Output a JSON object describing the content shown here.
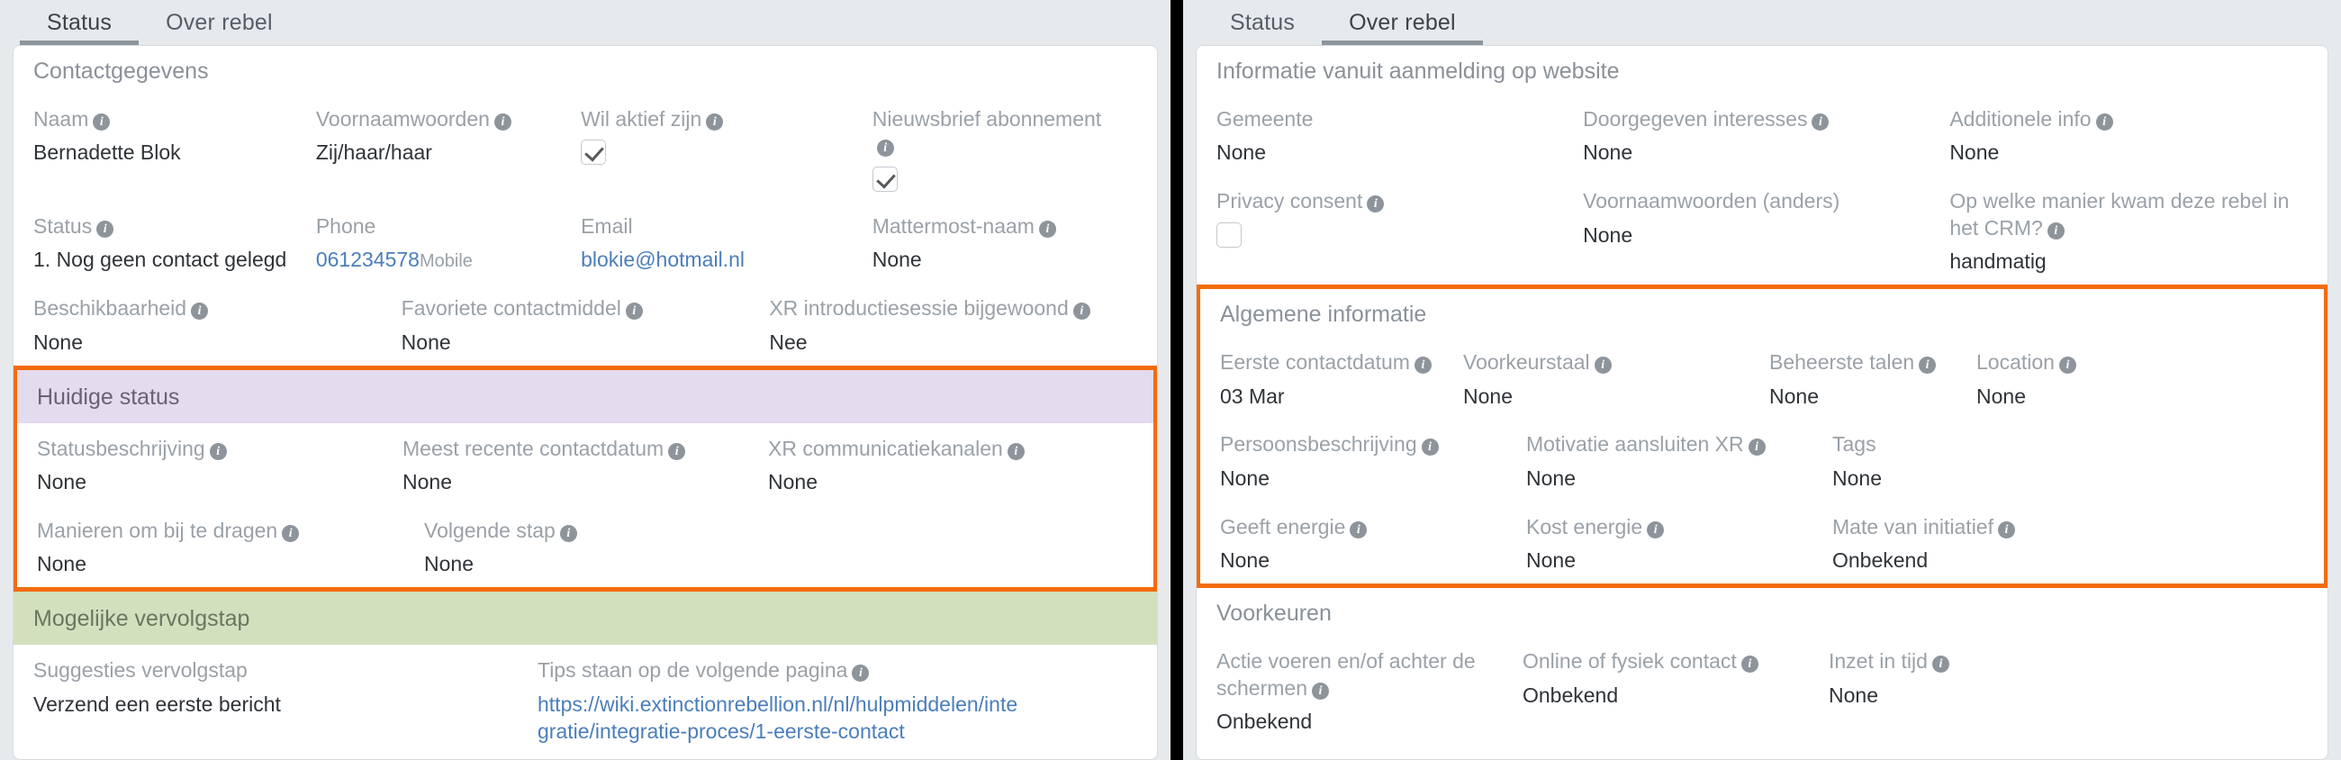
{
  "left_panel": {
    "tabs": [
      {
        "label": "Status",
        "active": true
      },
      {
        "label": "Over rebel",
        "active": false
      }
    ],
    "sections": [
      {
        "title": "Contactgegevens",
        "style": "plain",
        "rows": [
          [
            {
              "label": "Naam",
              "info": true,
              "value": "Bernadette Blok"
            },
            {
              "label": "Voornaamwoorden",
              "info": true,
              "value": "Zij/haar/haar"
            },
            {
              "label": "Wil aktief zijn",
              "info": true,
              "value": "",
              "checkbox": "checked"
            },
            {
              "label": "Nieuwsbrief abonnement",
              "info": true,
              "value": "",
              "checkbox": "checked",
              "label_wraps": true
            }
          ],
          [
            {
              "label": "Status",
              "info": true,
              "value": "1. Nog geen contact gelegd"
            },
            {
              "label": "Phone",
              "info": false,
              "value": "061234578",
              "value_link": true,
              "value_sub": "Mobile"
            },
            {
              "label": "Email",
              "info": false,
              "value": "blokie@hotmail.nl",
              "value_link": true
            },
            {
              "label": "Mattermost-naam",
              "info": true,
              "value": "None"
            }
          ],
          [
            {
              "label": "Beschikbaarheid",
              "info": true,
              "value": "None"
            },
            {
              "label": "Favoriete contactmiddel",
              "info": true,
              "value": "None"
            },
            {
              "label": "XR introductiesessie bijgewoond",
              "info": true,
              "value": "Nee"
            }
          ]
        ]
      },
      {
        "title": "Huidige status",
        "style": "purple",
        "highlighted": true,
        "rows": [
          [
            {
              "label": "Statusbeschrijving",
              "info": true,
              "value": "None"
            },
            {
              "label": "Meest recente contactdatum",
              "info": true,
              "value": "None"
            },
            {
              "label": "XR communicatiekanalen",
              "info": true,
              "value": "None"
            }
          ],
          [
            {
              "label": "Manieren om bij te dragen",
              "info": true,
              "value": "None"
            },
            {
              "label": "Volgende stap",
              "info": true,
              "value": "None"
            }
          ]
        ]
      },
      {
        "title": "Mogelijke vervolgstap",
        "style": "green",
        "rows": [
          [
            {
              "label": "Suggesties vervolgstap",
              "info": false,
              "value": "Verzend een eerste bericht"
            },
            {
              "label": "Tips staan op de volgende pagina",
              "info": true,
              "value": "https://wiki.extinctionrebellion.nl/nl/hulpmiddelen/integratie/integratie-proces/1-eerste-contact",
              "value_link": true
            }
          ]
        ]
      }
    ]
  },
  "right_panel": {
    "tabs": [
      {
        "label": "Status",
        "active": false
      },
      {
        "label": "Over rebel",
        "active": true
      }
    ],
    "sections": [
      {
        "title": "Informatie vanuit aanmelding op website",
        "style": "plain",
        "rows": [
          [
            {
              "label": "Gemeente",
              "info": false,
              "value": "None"
            },
            {
              "label": "Doorgegeven interesses",
              "info": true,
              "value": "None"
            },
            {
              "label": "Additionele info",
              "info": true,
              "value": "None"
            }
          ],
          [
            {
              "label": "Privacy consent",
              "info": true,
              "value": "",
              "checkbox": "unchecked"
            },
            {
              "label": "Voornaamwoorden (anders)",
              "info": false,
              "value": "None"
            },
            {
              "label": "Op welke manier kwam deze rebel in het CRM?",
              "info": true,
              "value": "handmatig",
              "label_wraps": true
            }
          ]
        ]
      },
      {
        "title": "Algemene informatie",
        "style": "plain",
        "highlighted": true,
        "rows": [
          [
            {
              "label": "Eerste contactdatum",
              "info": true,
              "value": "03 Mar"
            },
            {
              "label": "Voorkeurstaal",
              "info": true,
              "value": "None"
            },
            {
              "label": "Beheerste talen",
              "info": true,
              "value": "None"
            },
            {
              "label": "Location",
              "info": true,
              "value": "None"
            }
          ],
          [
            {
              "label": "Persoonsbeschrijving",
              "info": true,
              "value": "None"
            },
            {
              "label": "Motivatie aansluiten XR",
              "info": true,
              "value": "None"
            },
            {
              "label": "Tags",
              "info": false,
              "value": "None"
            }
          ],
          [
            {
              "label": "Geeft energie",
              "info": true,
              "value": "None"
            },
            {
              "label": "Kost energie",
              "info": true,
              "value": "None"
            },
            {
              "label": "Mate van initiatief",
              "info": true,
              "value": "Onbekend"
            }
          ]
        ]
      },
      {
        "title": "Voorkeuren",
        "style": "plain",
        "rows": [
          [
            {
              "label": "Actie voeren en/of achter de schermen",
              "info": true,
              "value": "Onbekend",
              "label_wraps": true
            },
            {
              "label": "Online of fysiek contact",
              "info": true,
              "value": "Onbekend"
            },
            {
              "label": "Inzet in tijd",
              "info": true,
              "value": "None"
            }
          ]
        ]
      }
    ]
  },
  "colors": {
    "accent_orange": "#f26c0d",
    "purple_header": "#e3dbee",
    "green_header": "#d3e0bd",
    "link_blue": "#4a7ebb",
    "tab_bar": "#e6eaed",
    "label_gray": "#9aa1a8"
  }
}
